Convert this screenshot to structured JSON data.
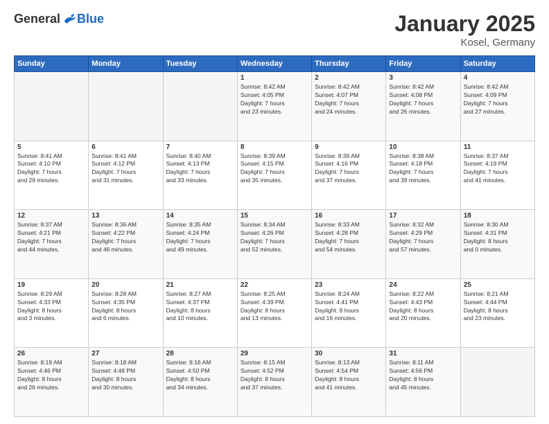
{
  "logo": {
    "general": "General",
    "blue": "Blue"
  },
  "title": "January 2025",
  "location": "Kosel, Germany",
  "days_header": [
    "Sunday",
    "Monday",
    "Tuesday",
    "Wednesday",
    "Thursday",
    "Friday",
    "Saturday"
  ],
  "weeks": [
    [
      {
        "day": "",
        "info": ""
      },
      {
        "day": "",
        "info": ""
      },
      {
        "day": "",
        "info": ""
      },
      {
        "day": "1",
        "info": "Sunrise: 8:42 AM\nSunset: 4:05 PM\nDaylight: 7 hours\nand 23 minutes."
      },
      {
        "day": "2",
        "info": "Sunrise: 8:42 AM\nSunset: 4:07 PM\nDaylight: 7 hours\nand 24 minutes."
      },
      {
        "day": "3",
        "info": "Sunrise: 8:42 AM\nSunset: 4:08 PM\nDaylight: 7 hours\nand 26 minutes."
      },
      {
        "day": "4",
        "info": "Sunrise: 8:42 AM\nSunset: 4:09 PM\nDaylight: 7 hours\nand 27 minutes."
      }
    ],
    [
      {
        "day": "5",
        "info": "Sunrise: 8:41 AM\nSunset: 4:10 PM\nDaylight: 7 hours\nand 29 minutes."
      },
      {
        "day": "6",
        "info": "Sunrise: 8:41 AM\nSunset: 4:12 PM\nDaylight: 7 hours\nand 31 minutes."
      },
      {
        "day": "7",
        "info": "Sunrise: 8:40 AM\nSunset: 4:13 PM\nDaylight: 7 hours\nand 33 minutes."
      },
      {
        "day": "8",
        "info": "Sunrise: 8:39 AM\nSunset: 4:15 PM\nDaylight: 7 hours\nand 35 minutes."
      },
      {
        "day": "9",
        "info": "Sunrise: 8:39 AM\nSunset: 4:16 PM\nDaylight: 7 hours\nand 37 minutes."
      },
      {
        "day": "10",
        "info": "Sunrise: 8:38 AM\nSunset: 4:18 PM\nDaylight: 7 hours\nand 39 minutes."
      },
      {
        "day": "11",
        "info": "Sunrise: 8:37 AM\nSunset: 4:19 PM\nDaylight: 7 hours\nand 41 minutes."
      }
    ],
    [
      {
        "day": "12",
        "info": "Sunrise: 8:37 AM\nSunset: 4:21 PM\nDaylight: 7 hours\nand 44 minutes."
      },
      {
        "day": "13",
        "info": "Sunrise: 8:36 AM\nSunset: 4:22 PM\nDaylight: 7 hours\nand 46 minutes."
      },
      {
        "day": "14",
        "info": "Sunrise: 8:35 AM\nSunset: 4:24 PM\nDaylight: 7 hours\nand 49 minutes."
      },
      {
        "day": "15",
        "info": "Sunrise: 8:34 AM\nSunset: 4:26 PM\nDaylight: 7 hours\nand 52 minutes."
      },
      {
        "day": "16",
        "info": "Sunrise: 8:33 AM\nSunset: 4:28 PM\nDaylight: 7 hours\nand 54 minutes."
      },
      {
        "day": "17",
        "info": "Sunrise: 8:32 AM\nSunset: 4:29 PM\nDaylight: 7 hours\nand 57 minutes."
      },
      {
        "day": "18",
        "info": "Sunrise: 8:30 AM\nSunset: 4:31 PM\nDaylight: 8 hours\nand 0 minutes."
      }
    ],
    [
      {
        "day": "19",
        "info": "Sunrise: 8:29 AM\nSunset: 4:33 PM\nDaylight: 8 hours\nand 3 minutes."
      },
      {
        "day": "20",
        "info": "Sunrise: 8:28 AM\nSunset: 4:35 PM\nDaylight: 8 hours\nand 6 minutes."
      },
      {
        "day": "21",
        "info": "Sunrise: 8:27 AM\nSunset: 4:37 PM\nDaylight: 8 hours\nand 10 minutes."
      },
      {
        "day": "22",
        "info": "Sunrise: 8:25 AM\nSunset: 4:39 PM\nDaylight: 8 hours\nand 13 minutes."
      },
      {
        "day": "23",
        "info": "Sunrise: 8:24 AM\nSunset: 4:41 PM\nDaylight: 8 hours\nand 16 minutes."
      },
      {
        "day": "24",
        "info": "Sunrise: 8:22 AM\nSunset: 4:43 PM\nDaylight: 8 hours\nand 20 minutes."
      },
      {
        "day": "25",
        "info": "Sunrise: 8:21 AM\nSunset: 4:44 PM\nDaylight: 8 hours\nand 23 minutes."
      }
    ],
    [
      {
        "day": "26",
        "info": "Sunrise: 8:19 AM\nSunset: 4:46 PM\nDaylight: 8 hours\nand 26 minutes."
      },
      {
        "day": "27",
        "info": "Sunrise: 8:18 AM\nSunset: 4:48 PM\nDaylight: 8 hours\nand 30 minutes."
      },
      {
        "day": "28",
        "info": "Sunrise: 8:16 AM\nSunset: 4:50 PM\nDaylight: 8 hours\nand 34 minutes."
      },
      {
        "day": "29",
        "info": "Sunrise: 8:15 AM\nSunset: 4:52 PM\nDaylight: 8 hours\nand 37 minutes."
      },
      {
        "day": "30",
        "info": "Sunrise: 8:13 AM\nSunset: 4:54 PM\nDaylight: 8 hours\nand 41 minutes."
      },
      {
        "day": "31",
        "info": "Sunrise: 8:11 AM\nSunset: 4:56 PM\nDaylight: 8 hours\nand 45 minutes."
      },
      {
        "day": "",
        "info": ""
      }
    ]
  ]
}
